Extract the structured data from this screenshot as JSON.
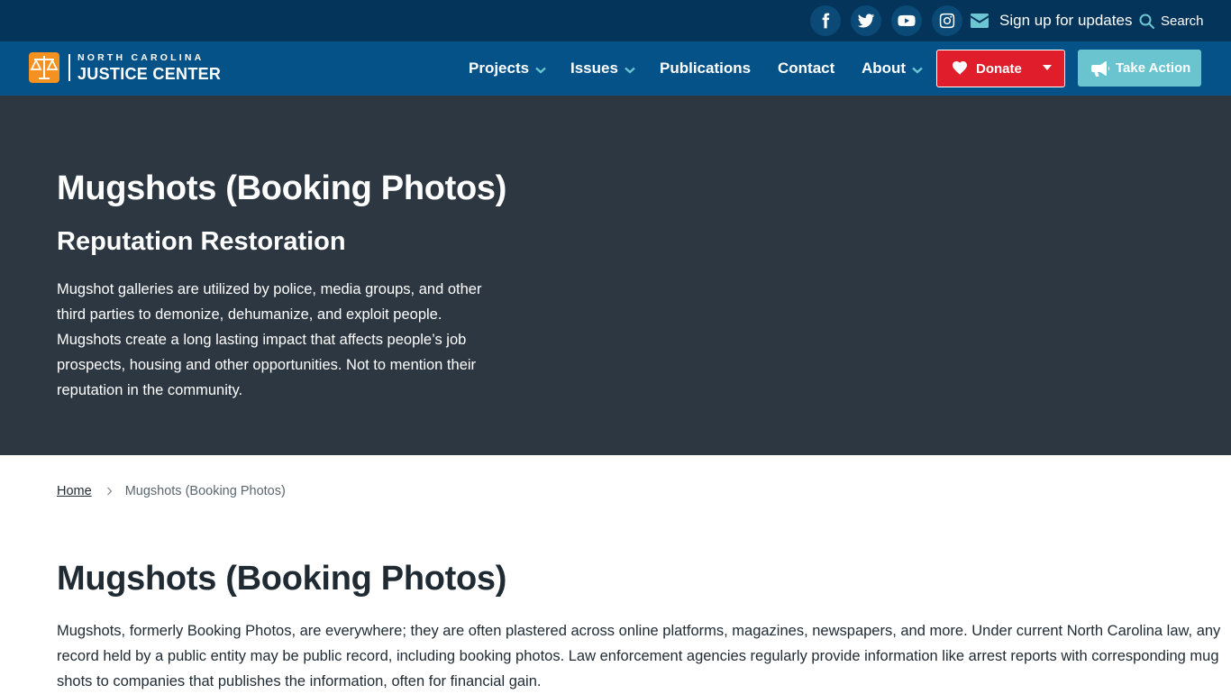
{
  "topbar": {
    "social_icons": [
      "facebook-icon",
      "twitter-icon",
      "youtube-icon",
      "instagram-icon"
    ],
    "signup_label": "Sign up for updates",
    "search_label": "Search"
  },
  "nav": {
    "logo_top": "NORTH CAROLINA",
    "logo_bottom": "JUSTICE CENTER",
    "items": [
      {
        "label": "Projects",
        "has_dropdown": true
      },
      {
        "label": "Issues",
        "has_dropdown": true
      },
      {
        "label": "Publications",
        "has_dropdown": false
      },
      {
        "label": "Contact",
        "has_dropdown": false
      },
      {
        "label": "About",
        "has_dropdown": true
      }
    ],
    "donate_label": "Donate",
    "take_action_label": "Take Action"
  },
  "hero": {
    "title": "Mugshots (Booking Photos)",
    "subtitle": "Reputation Restoration",
    "description": "Mugshot galleries are utilized by police, media groups, and other third parties to demonize, dehumanize, and exploit people. Mugshots create a long lasting impact that affects people’s job prospects, housing and other opportunities. Not to mention their reputation in the community."
  },
  "breadcrumb": {
    "home": "Home",
    "current": "Mugshots (Booking Photos)"
  },
  "content": {
    "title": "Mugshots (Booking Photos)",
    "lines": [
      "Mugshots, formerly Booking Photos, are everywhere; they are often plastered across online platforms, magazines, newspapers, and more. Under current North Carolina law, any",
      "record held by a public entity may be public record, including booking photos. Law enforcement agencies regularly provide information like arrest reports with corresponding mug",
      "shots to companies that publishes the information, often for financial gain."
    ]
  },
  "colors": {
    "topbar": "#043459",
    "nav": "#045287",
    "hero": "#2c3741",
    "accent_teal": "#69c4cf",
    "donate_red": "#e01e2b",
    "logo_orange": "#f5921f"
  }
}
